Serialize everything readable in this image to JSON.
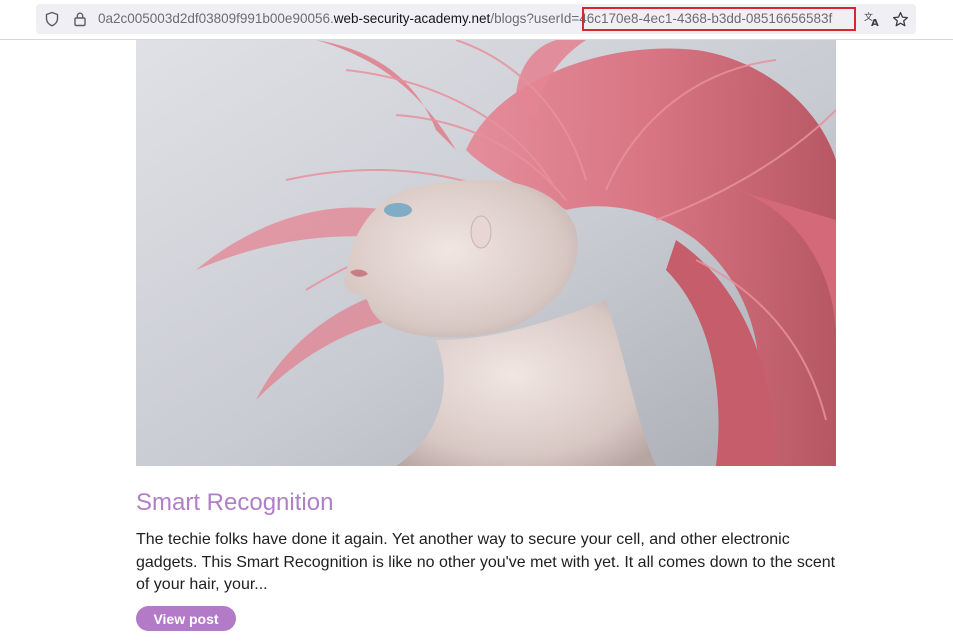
{
  "browser": {
    "url": {
      "prefix": "0a2c005003d2df03809f991b00e90056.",
      "domain": "web-security-academy.net",
      "path": "/blogs?userId=",
      "param_value": "46c170e8-4ec1-4368-b3dd-08516656583f"
    },
    "icons": [
      "shield-icon",
      "lock-icon",
      "translate-icon",
      "star-icon"
    ],
    "highlight_color": "#d9262f"
  },
  "post": {
    "image_subject": "woman with flowing pink hair",
    "title": "Smart Recognition",
    "summary": "The techie folks have done it again. Yet another way to secure your cell, and other electronic gadgets. This Smart Recognition is like no other you've met with yet. It all comes down to the scent of your hair, your...",
    "view_button": "View post"
  },
  "colors": {
    "accent": "#b37bc7",
    "title": "#b17ec8",
    "text": "#1f1f1f"
  }
}
